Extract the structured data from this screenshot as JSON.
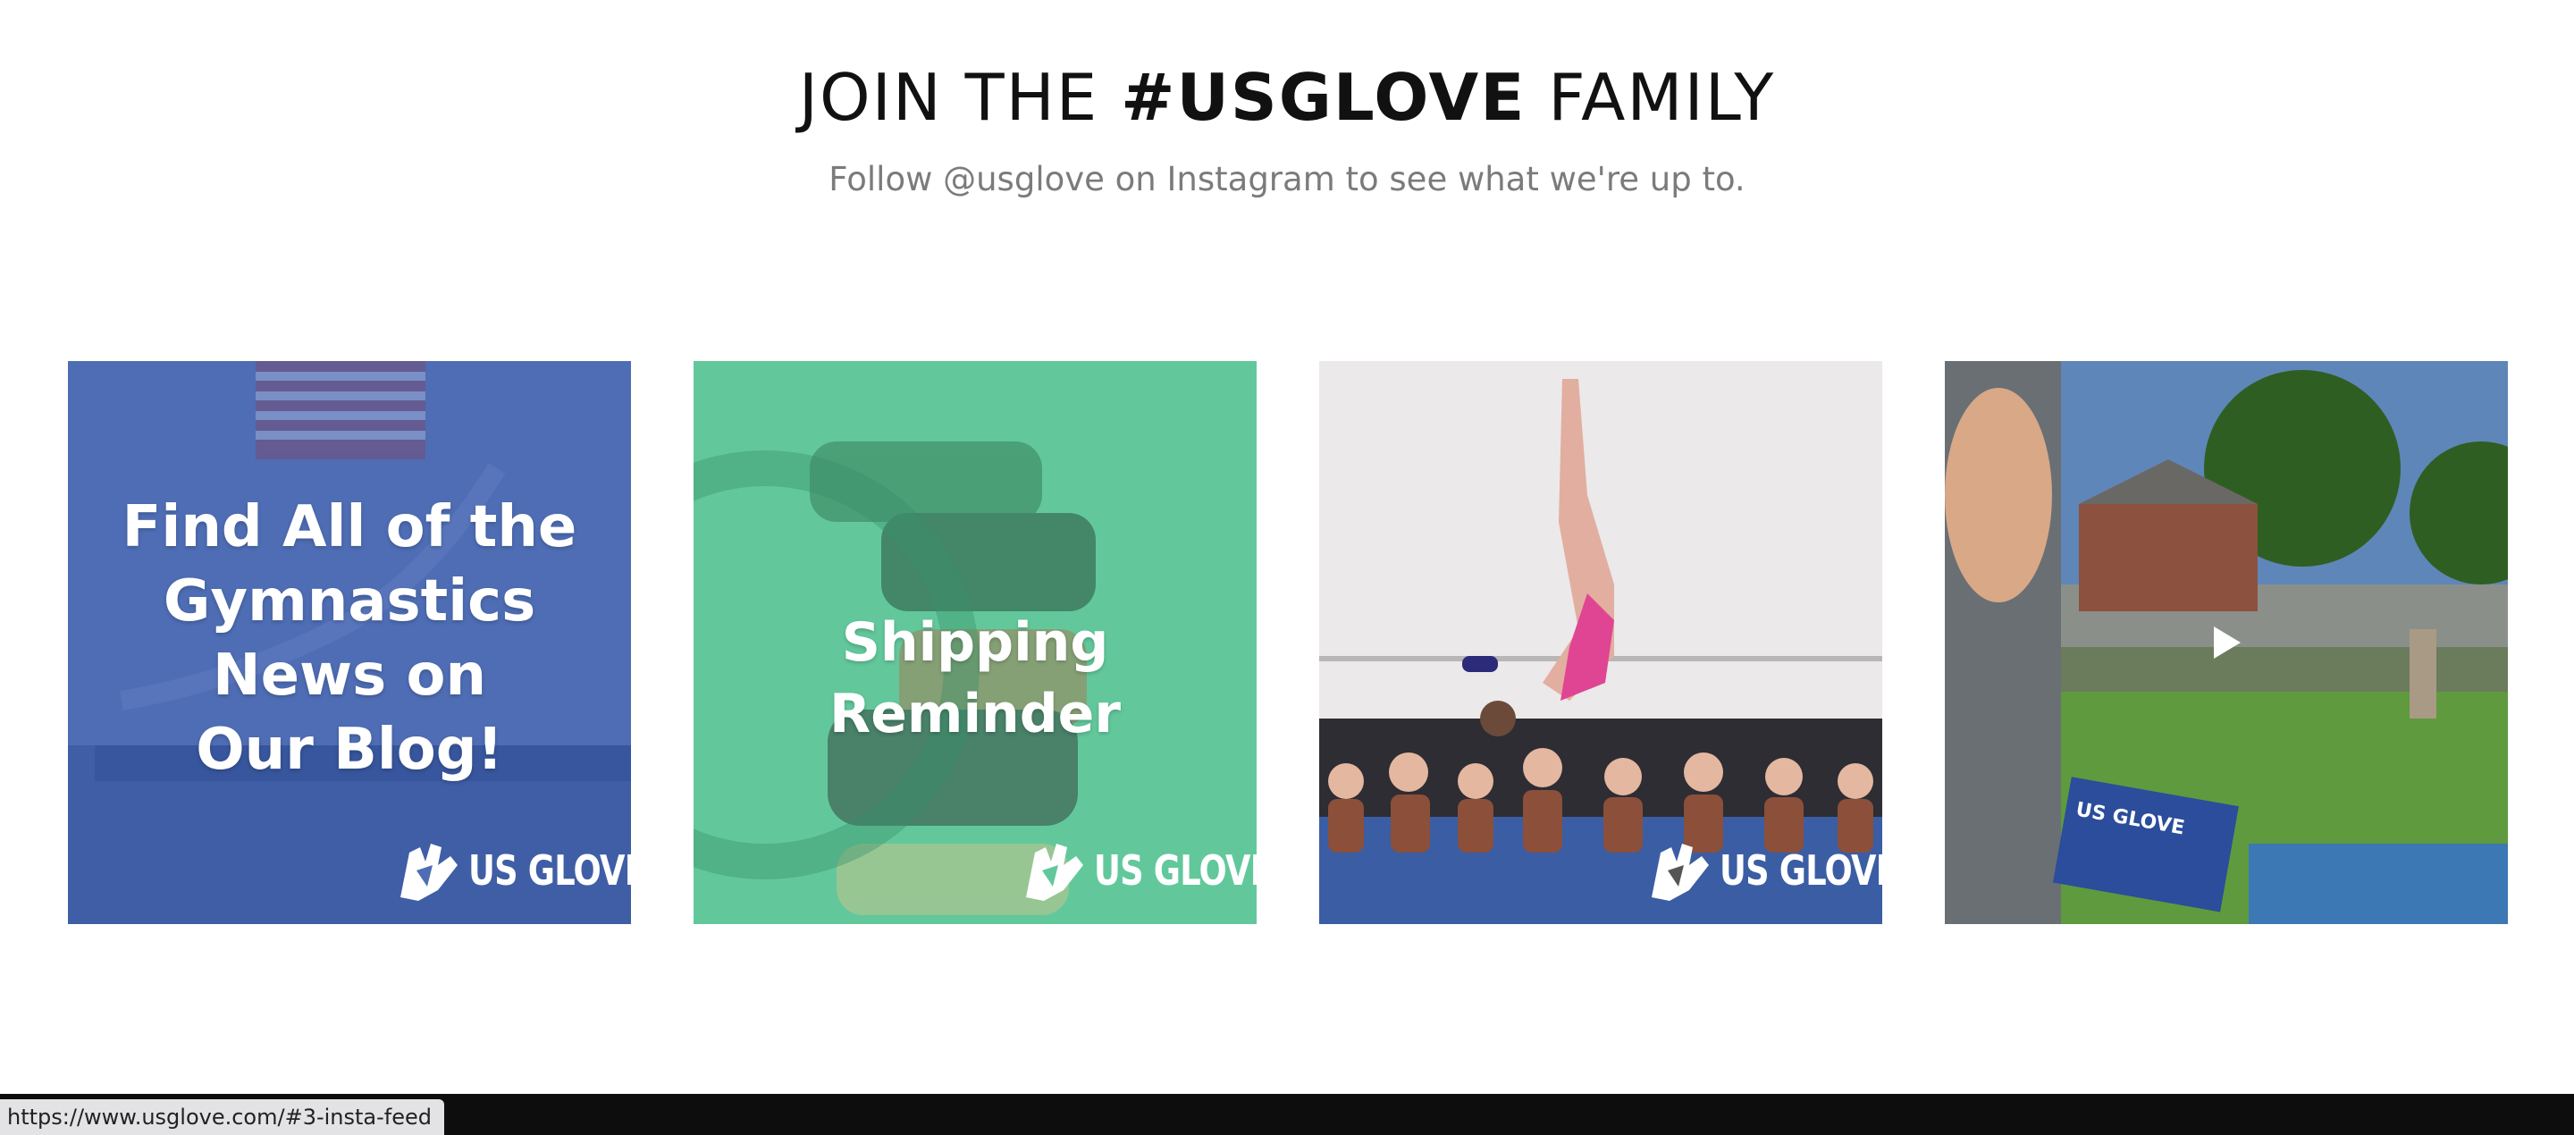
{
  "section": {
    "heading_pre": "JOIN THE ",
    "heading_hashtag": "#USGLOVE",
    "heading_post": " FAMILY",
    "subtitle": "Follow @usglove on Instagram to see what we're up to."
  },
  "feed": {
    "posts": [
      {
        "overlay_lines": [
          "Find All of the",
          "Gymnastics",
          "News on",
          "Our Blog!"
        ],
        "brand": "US GLOVE",
        "accent": "#4b6bb3"
      },
      {
        "overlay": "Shipping Reminder",
        "brand": "US GLOVE",
        "accent": "#5ec79a"
      },
      {
        "brand": "US GLOVE",
        "accent": "#e9e7e8"
      },
      {
        "video": true,
        "icon": "play-icon",
        "package_label": "US GLOVE"
      }
    ]
  },
  "status": {
    "url": "https://www.usglove.com/#3-insta-feed"
  }
}
